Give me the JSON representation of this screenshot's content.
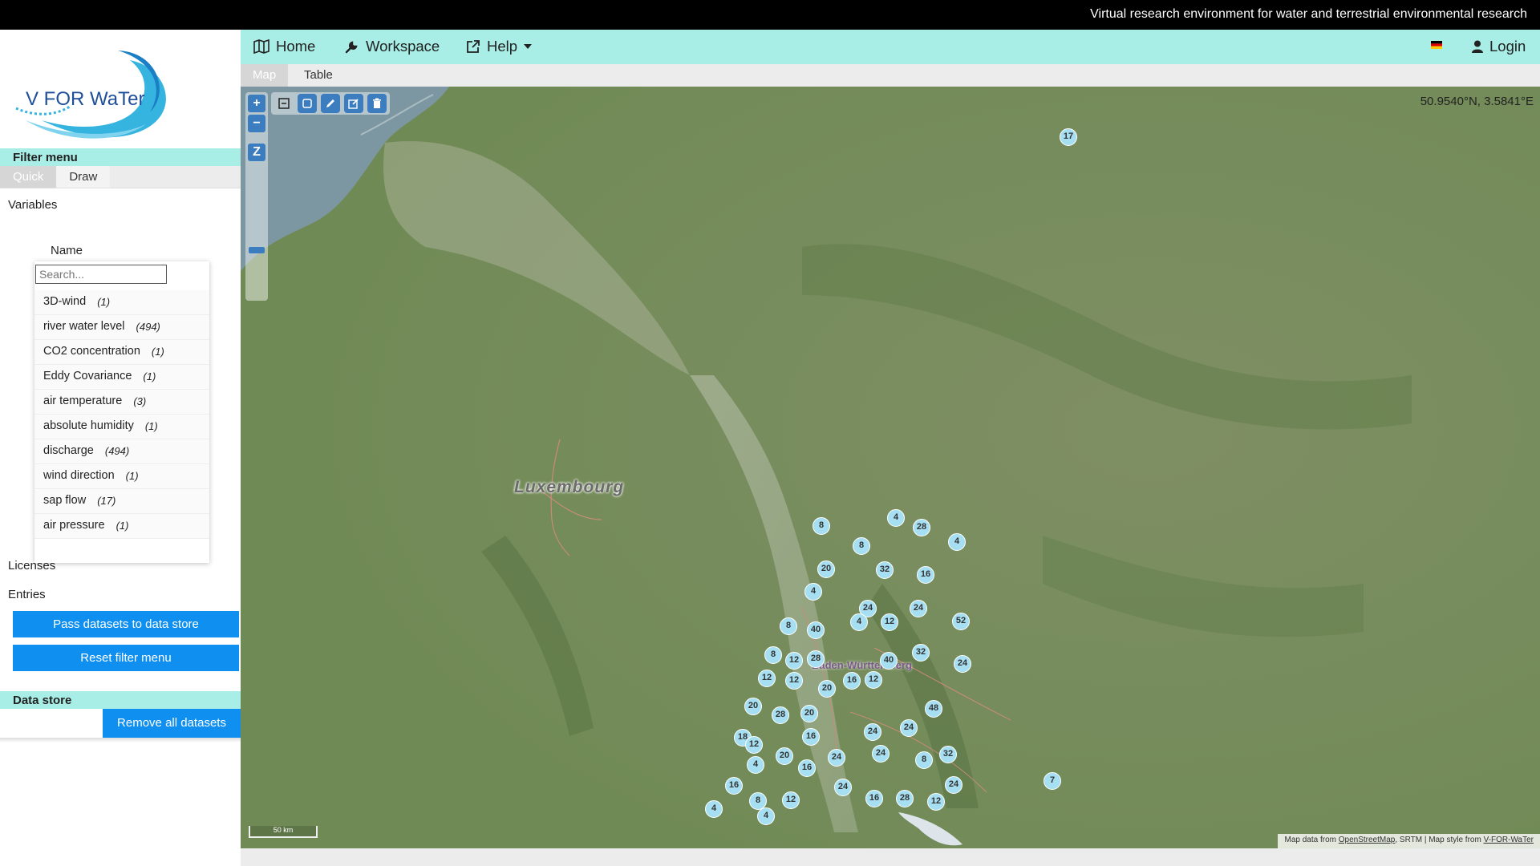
{
  "topbar": {
    "tagline": "Virtual research environment for water and terrestrial environmental research"
  },
  "logo": {
    "text": "V FOR WaTer"
  },
  "filter_menu": {
    "title": "Filter menu",
    "tabs": [
      {
        "label": "Quick",
        "active": true
      },
      {
        "label": "Draw",
        "active": false
      }
    ],
    "variables_label": "Variables",
    "name_label": "Name",
    "search_placeholder": "Search...",
    "variables": [
      {
        "name": "3D-wind",
        "count": "(1)"
      },
      {
        "name": "river water level",
        "count": "(494)"
      },
      {
        "name": "CO2 concentration",
        "count": "(1)"
      },
      {
        "name": "Eddy Covariance",
        "count": "(1)"
      },
      {
        "name": "air temperature",
        "count": "(3)"
      },
      {
        "name": "absolute humidity",
        "count": "(1)"
      },
      {
        "name": "discharge",
        "count": "(494)"
      },
      {
        "name": "wind direction",
        "count": "(1)"
      },
      {
        "name": "sap flow",
        "count": "(17)"
      },
      {
        "name": "air pressure",
        "count": "(1)"
      }
    ],
    "licenses_label": "Licenses",
    "entries_label": "Entries",
    "pass_button": "Pass datasets to data store",
    "reset_button": "Reset filter menu"
  },
  "data_store": {
    "title": "Data store",
    "remove_button": "Remove all datasets"
  },
  "nav": {
    "home": "Home",
    "workspace": "Workspace",
    "help": "Help",
    "login": "Login"
  },
  "map_tabs": [
    {
      "label": "Map",
      "active": true
    },
    {
      "label": "Table",
      "active": false
    }
  ],
  "map": {
    "coordinates": "50.9540°N, 3.5841°E",
    "zoom_in": "+",
    "zoom_out": "−",
    "zoom_extent": "Z",
    "label_luxembourg": "Luxembourg",
    "label_bw": "Baden-Württemberg",
    "scale_label": "50 km",
    "attribution": {
      "prefix": "Map data from",
      "osm": "OpenStreetMap",
      "middle": ", SRTM | Map style from",
      "vforwater": "V-FOR-WaTer"
    },
    "cluster_counts": [
      "17",
      "8",
      "4",
      "28",
      "4",
      "8",
      "20",
      "32",
      "16",
      "4",
      "24",
      "24",
      "4",
      "12",
      "52",
      "8",
      "40",
      "8",
      "12",
      "28",
      "40",
      "32",
      "24",
      "12",
      "12",
      "16",
      "12",
      "20",
      "20",
      "28",
      "48",
      "20",
      "16",
      "24",
      "24",
      "18",
      "12",
      "4",
      "20",
      "16",
      "24",
      "24",
      "8",
      "32",
      "16",
      "24",
      "28",
      "24",
      "8",
      "12",
      "4",
      "12",
      "16",
      "4",
      "7"
    ]
  },
  "colors": {
    "accent_teal": "#a8ede6",
    "button_blue": "#0f8ff0",
    "marker_blue": "#a6dff2",
    "map_green": "#7c9461"
  }
}
